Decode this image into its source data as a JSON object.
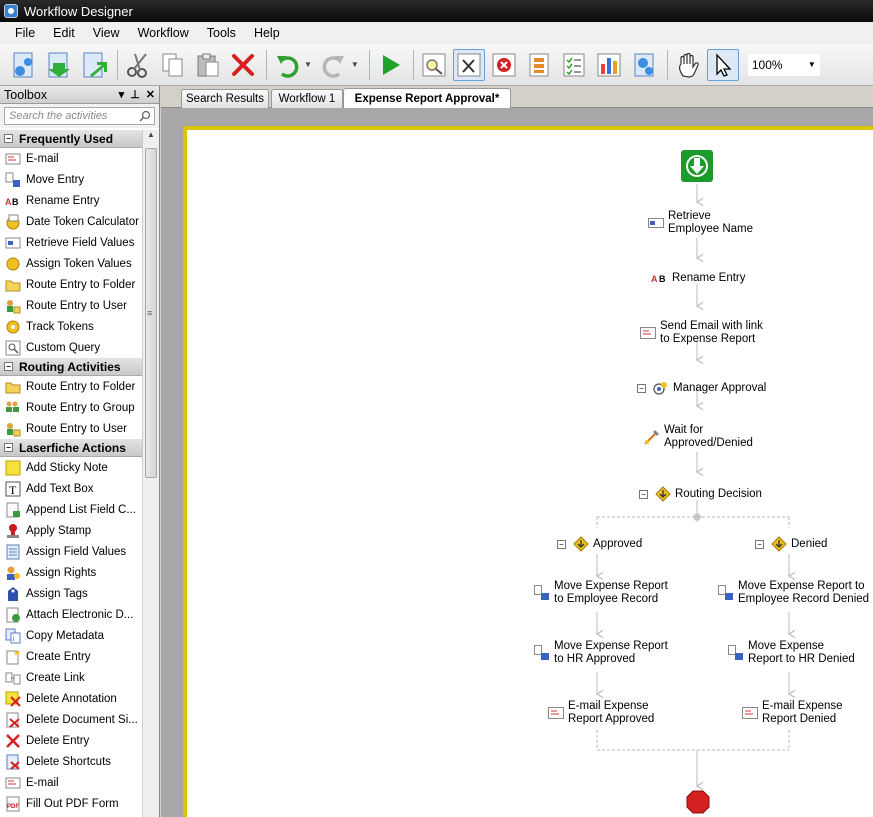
{
  "window": {
    "title": "Workflow Designer"
  },
  "menu": [
    "File",
    "Edit",
    "View",
    "Workflow",
    "Tools",
    "Help"
  ],
  "toolbar": {
    "zoom": "100%",
    "buttons": [
      "new-workflow-icon",
      "open-workflow-icon",
      "save-workflow-icon",
      "cut-icon",
      "copy-icon",
      "paste-icon",
      "delete-icon",
      "undo-icon",
      "redo-icon",
      "run-icon",
      "find-icon",
      "tools-icon",
      "stop-icon",
      "properties-icon",
      "checklist-icon",
      "report-icon",
      "monitor-icon",
      "hand-icon",
      "pointer-icon"
    ]
  },
  "toolbox": {
    "title": "Toolbox",
    "search_placeholder": "Search the activities",
    "categories": [
      {
        "name": "Frequently Used",
        "items": [
          "E-mail",
          "Move Entry",
          "Rename Entry",
          "Date Token Calculator",
          "Retrieve Field Values",
          "Assign Token Values",
          "Route Entry to Folder",
          "Route Entry to User",
          "Track Tokens",
          "Custom Query"
        ]
      },
      {
        "name": "Routing Activities",
        "items": [
          "Route Entry to Folder",
          "Route Entry to Group",
          "Route Entry to User"
        ]
      },
      {
        "name": "Laserfiche Actions",
        "items": [
          "Add Sticky Note",
          "Add Text Box",
          "Append List Field C...",
          "Apply Stamp",
          "Assign Field Values",
          "Assign Rights",
          "Assign Tags",
          "Attach Electronic D...",
          "Copy Metadata",
          "Create Entry",
          "Create Link",
          "Delete Annotation",
          "Delete Document Si...",
          "Delete Entry",
          "Delete Shortcuts",
          "E-mail",
          "Fill Out PDF Form"
        ]
      }
    ]
  },
  "tabs": [
    "Search Results",
    "Workflow 1",
    "Expense Report Approval*"
  ],
  "workflow": {
    "steps": {
      "retrieve": [
        "Retrieve",
        "Employee Name"
      ],
      "rename": "Rename Entry",
      "send_email": [
        "Send Email with link",
        "to Expense Report"
      ],
      "manager": "Manager Approval",
      "wait": [
        "Wait for",
        "Approved/Denied"
      ],
      "routing": "Routing Decision"
    },
    "branches": {
      "approved": {
        "label": "Approved",
        "move1": [
          "Move Expense Report",
          "to Employee Record"
        ],
        "move2": [
          "Move Expense Report",
          "to HR Approved"
        ],
        "email": [
          "E-mail Expense",
          "Report Approved"
        ]
      },
      "denied": {
        "label": "Denied",
        "move1": [
          "Move Expense Report to",
          "Employee Record Denied"
        ],
        "move2": [
          "Move Expense",
          "Report to HR Denied"
        ],
        "email": [
          "E-mail Expense",
          "Report Denied"
        ]
      }
    }
  },
  "colors": {
    "canvas_border": "#d9c400",
    "start": "#1e9a2c",
    "stop": "#d42020"
  }
}
